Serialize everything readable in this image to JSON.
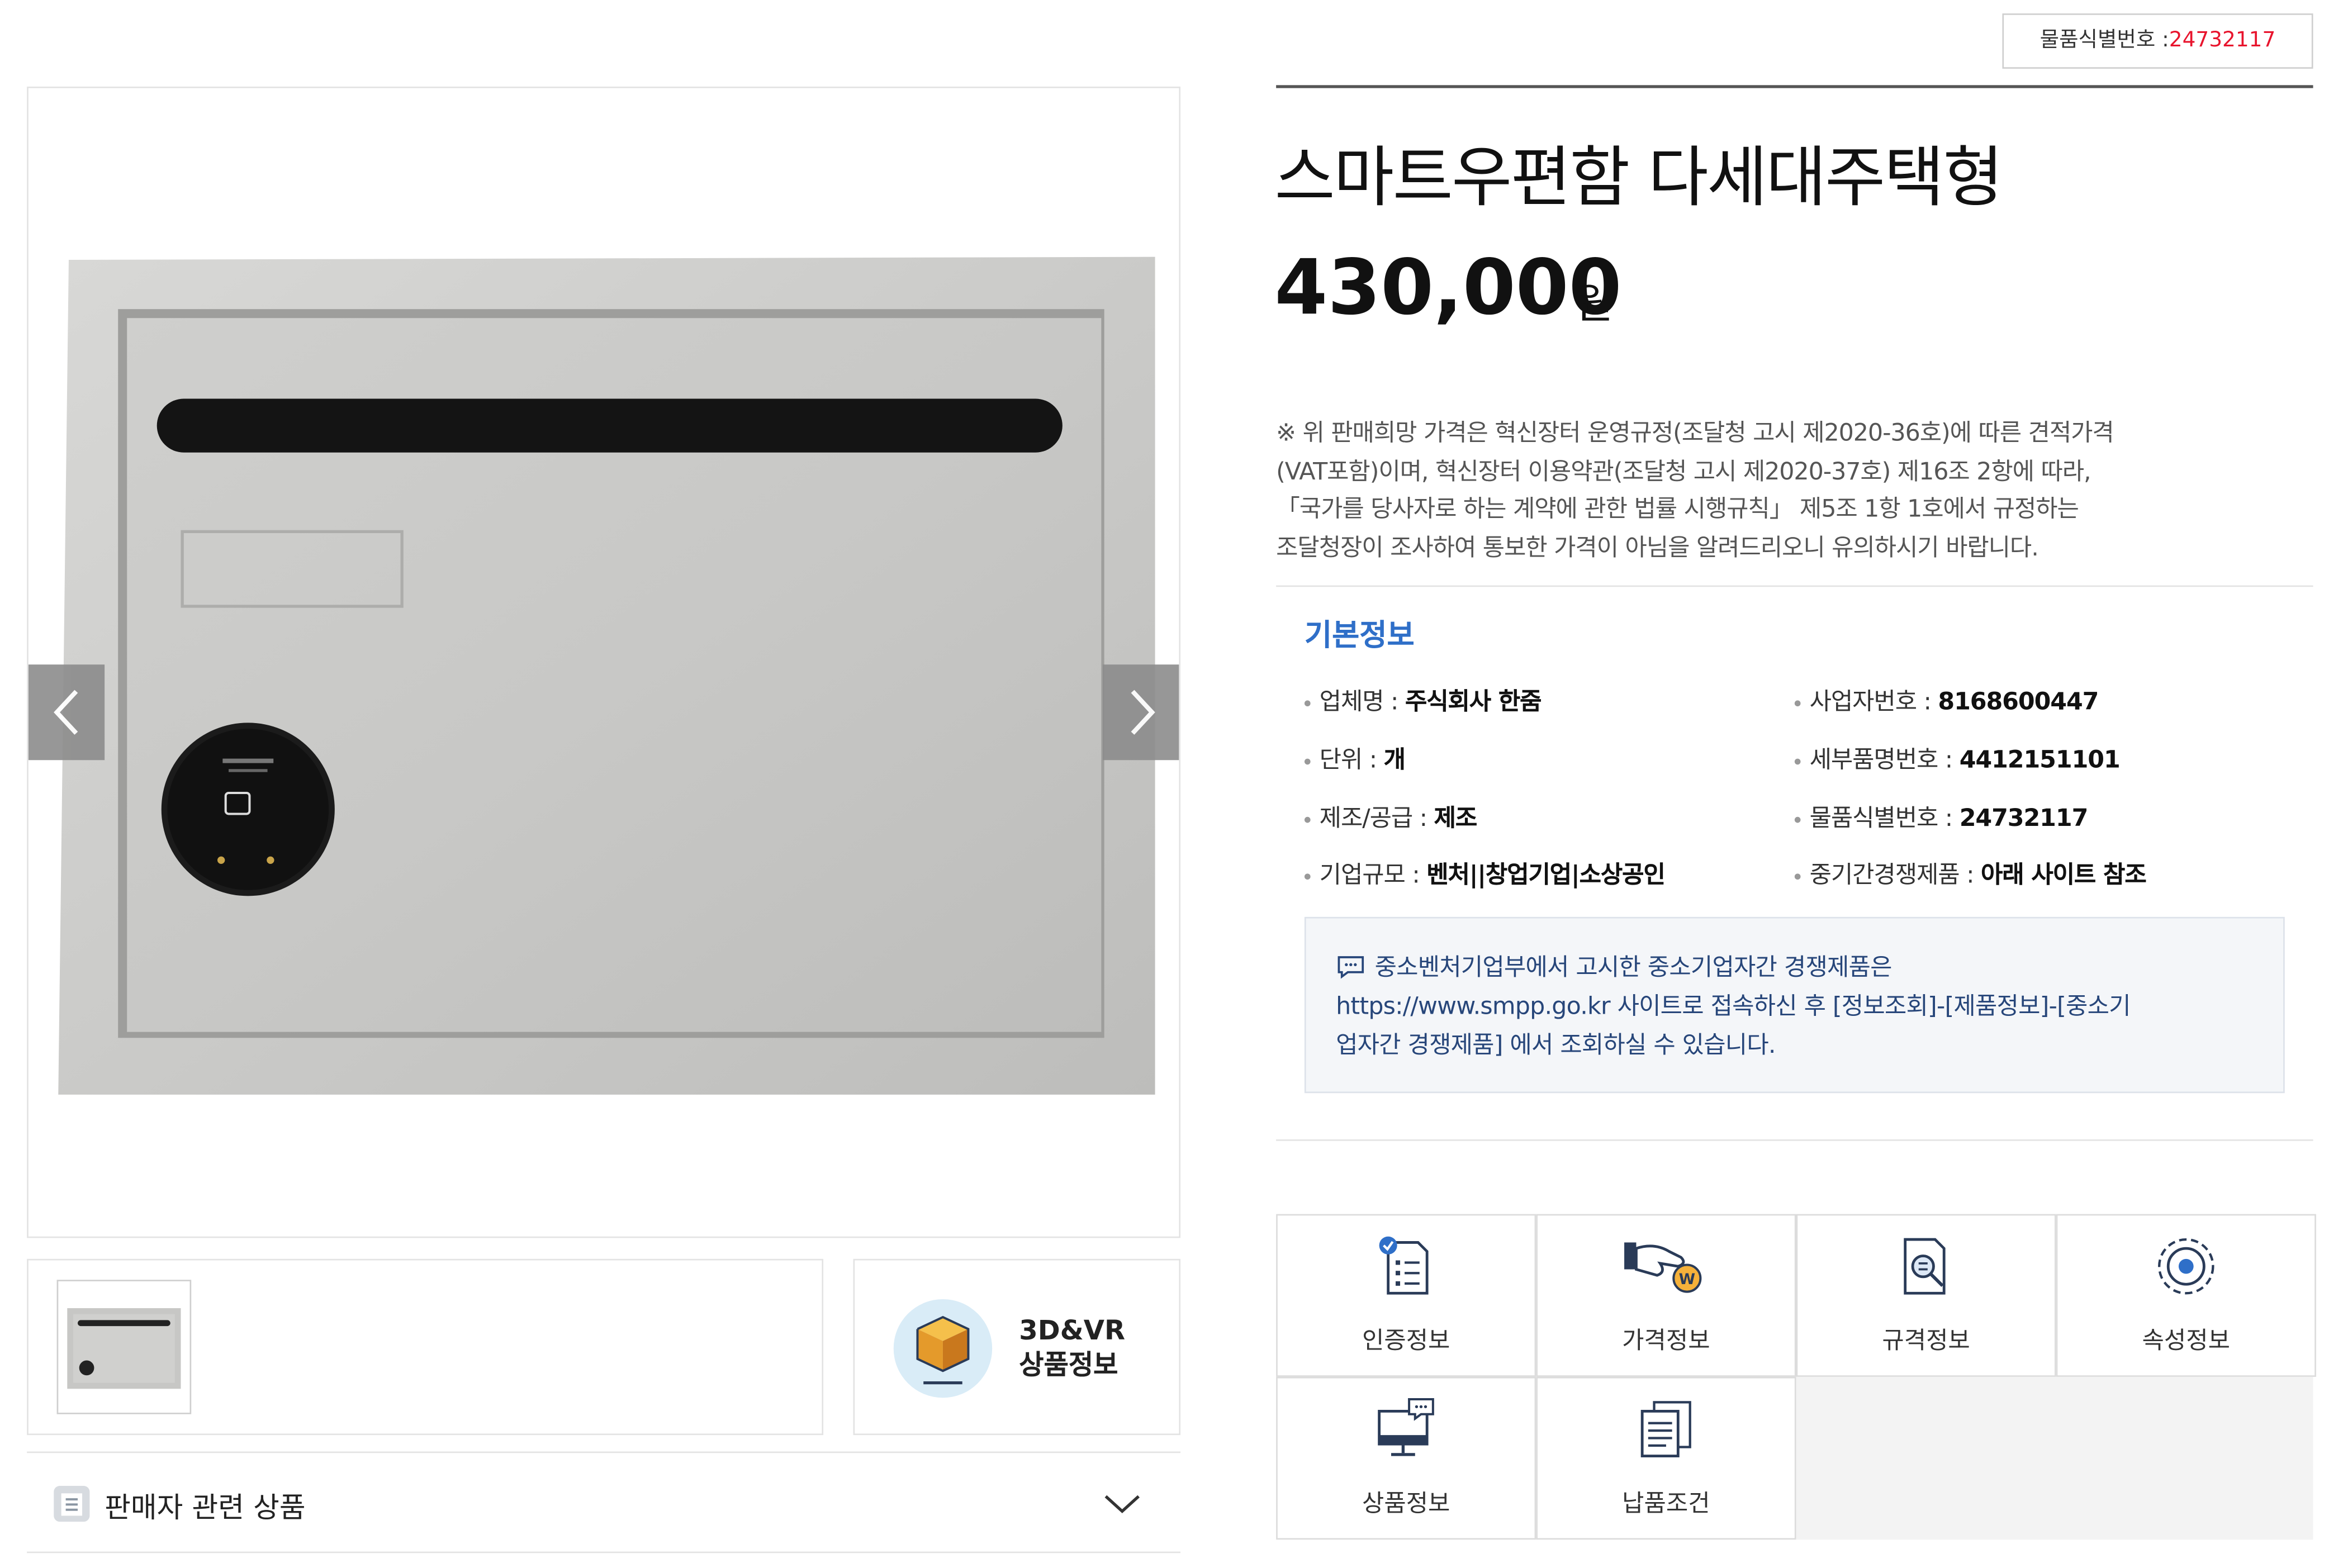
{
  "product_id_badge": {
    "label": "물품식별번호 :",
    "value": "24732117"
  },
  "product": {
    "title": "스마트우편함 다세대주택형",
    "price": "430,000",
    "price_unit": "원"
  },
  "notice_lines": [
    "※ 위 판매희망 가격은 혁신장터 운영규정(조달청 고시 제2020-36호)에 따른 견적가격",
    "(VAT포함)이며, 혁신장터 이용약관(조달청 고시 제2020-37호) 제16조 2항에 따라,",
    "「국가를 당사자로 하는 계약에 관한 법률 시행규칙」 제5조 1항 1호에서 규정하는",
    "조달청장이 조사하여 통보한 가격이 아님을 알려드리오니 유의하시기 바랍니다."
  ],
  "basic_info": {
    "title": "기본정보",
    "items": [
      {
        "label": "업체명 :",
        "value": "주식회사 한줌"
      },
      {
        "label": "사업자번호 :",
        "value": "8168600447"
      },
      {
        "label": "단위 :",
        "value": "개"
      },
      {
        "label": "세부품명번호 :",
        "value": "4412151101"
      },
      {
        "label": "제조/공급 :",
        "value": "제조"
      },
      {
        "label": "물품식별번호 :",
        "value": "24732117"
      },
      {
        "label": "기업규모 :",
        "value": "벤처||창업기업|소상공인"
      },
      {
        "label": "중기간경쟁제품 :",
        "value": "아래 사이트 참조"
      }
    ],
    "notice": [
      "중소벤처기업부에서 고시한 중소기업자간 경쟁제품은",
      "https://www.smpp.go.kr 사이트로 접속하신 후 [정보조회]-[제품정보]-[중소기",
      "업자간 경쟁제품] 에서 조회하실 수 있습니다."
    ]
  },
  "vr_button": {
    "line1": "3D&VR",
    "line2": "상품정보"
  },
  "seller_related": {
    "label": "판매자 관련 상품"
  },
  "tabs": [
    {
      "label": "인증정보",
      "icon": "certificate-icon"
    },
    {
      "label": "가격정보",
      "icon": "price-hand-icon"
    },
    {
      "label": "규격정보",
      "icon": "spec-search-icon"
    },
    {
      "label": "속성정보",
      "icon": "gear-icon"
    },
    {
      "label": "상품정보",
      "icon": "monitor-chat-icon"
    },
    {
      "label": "납품조건",
      "icon": "documents-icon"
    }
  ]
}
